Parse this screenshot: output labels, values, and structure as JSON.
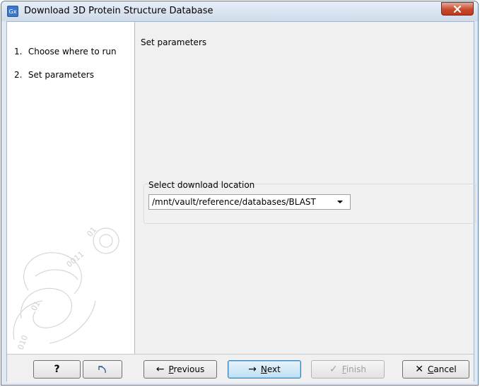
{
  "window": {
    "title": "Download 3D Protein Structure Database",
    "app_icon_text": "Gx"
  },
  "steps": [
    {
      "num": "1.",
      "label": "Choose where to run"
    },
    {
      "num": "2.",
      "label": "Set parameters"
    }
  ],
  "main": {
    "section_title": "Set parameters",
    "download_location": {
      "label": "Select download location",
      "value": "/mnt/vault/reference/databases/BLAST"
    }
  },
  "buttons": {
    "help": "?",
    "previous_first": "P",
    "previous_rest": "revious",
    "next_first": "N",
    "next_rest": "ext",
    "finish_first": "F",
    "finish_rest": "inish",
    "cancel_first": "C",
    "cancel_rest": "ancel"
  },
  "colors": {
    "title_bar": "#cfdbea",
    "close_button": "#c8492c",
    "default_button_border": "#3c7fb1"
  }
}
